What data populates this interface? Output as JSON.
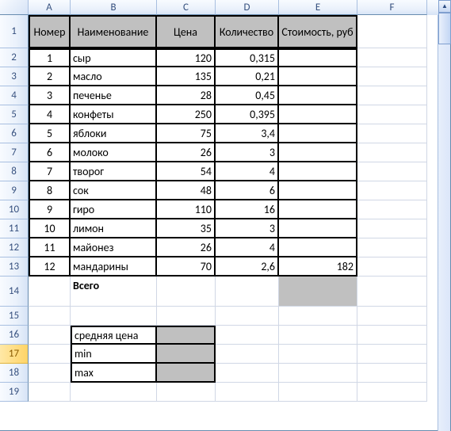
{
  "columns": [
    "A",
    "B",
    "C",
    "D",
    "E",
    "F"
  ],
  "rowLabels": [
    "1",
    "2",
    "3",
    "4",
    "5",
    "6",
    "7",
    "8",
    "9",
    "10",
    "11",
    "12",
    "13",
    "14",
    "15",
    "16",
    "17",
    "18",
    "19"
  ],
  "selectedRow": "17",
  "header": {
    "A": "Номер",
    "B": "Наименование",
    "C": "Цена",
    "D": "Количество",
    "E": "Стоимость, руб"
  },
  "rows": [
    {
      "n": "1",
      "name": "сыр",
      "price": "120",
      "qty": "0,315",
      "cost": ""
    },
    {
      "n": "2",
      "name": "масло",
      "price": "135",
      "qty": "0,21",
      "cost": ""
    },
    {
      "n": "3",
      "name": "печенье",
      "price": "28",
      "qty": "0,45",
      "cost": ""
    },
    {
      "n": "4",
      "name": "конфеты",
      "price": "250",
      "qty": "0,395",
      "cost": ""
    },
    {
      "n": "5",
      "name": "яблоки",
      "price": "75",
      "qty": "3,4",
      "cost": ""
    },
    {
      "n": "6",
      "name": "молоко",
      "price": "26",
      "qty": "3",
      "cost": ""
    },
    {
      "n": "7",
      "name": "творог",
      "price": "54",
      "qty": "4",
      "cost": ""
    },
    {
      "n": "8",
      "name": "сок",
      "price": "48",
      "qty": "6",
      "cost": ""
    },
    {
      "n": "9",
      "name": "гиро",
      "price": "110",
      "qty": "16",
      "cost": ""
    },
    {
      "n": "10",
      "name": "лимон",
      "price": "35",
      "qty": "3",
      "cost": ""
    },
    {
      "n": "11",
      "name": "майонез",
      "price": "26",
      "qty": "4",
      "cost": ""
    },
    {
      "n": "12",
      "name": "мандарины",
      "price": "70",
      "qty": "2,6",
      "cost": "182"
    }
  ],
  "totalLabel": "Всего",
  "stats": {
    "avg": "средняя цена",
    "min": "min",
    "max": "max"
  }
}
